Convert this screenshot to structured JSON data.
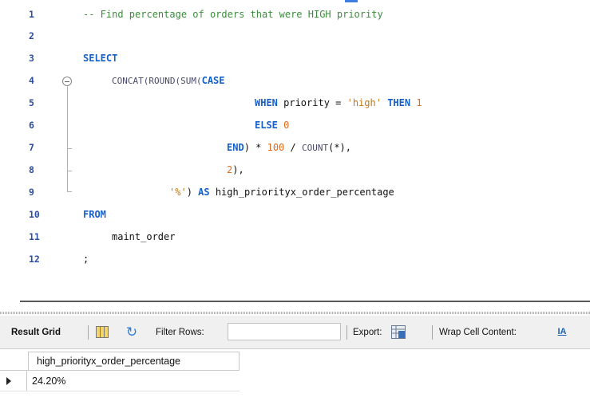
{
  "editor": {
    "line_numbers": [
      "1",
      "2",
      "3",
      "4",
      "5",
      "6",
      "7",
      "8",
      "9",
      "10",
      "11",
      "12"
    ],
    "line1_comment": "-- Find percentage of orders that were HIGH priority",
    "line3_select": "SELECT",
    "line4_concat": "CONCAT(",
    "line4_round": "ROUND(",
    "line4_sum": "SUM(",
    "line4_case": "CASE",
    "line5_when": "WHEN",
    "line5_col": " priority = ",
    "line5_str": "'high'",
    "line5_then": " THEN ",
    "line5_num": "1",
    "line6_else": "ELSE ",
    "line6_num": "0",
    "line7_end": "END",
    "line7_mid": ") * ",
    "line7_num": "100",
    "line7_div": " / ",
    "line7_count": "COUNT",
    "line7_tail": "(*),",
    "line8_num": "2",
    "line8_tail": "),",
    "line9_str": "'%'",
    "line9_paren": ") ",
    "line9_as": "AS",
    "line9_alias": " high_priorityx_order_percentage",
    "line10_from": "FROM",
    "line11_table": "maint_order",
    "line12_semi": ";"
  },
  "toolbar": {
    "result_grid_label": "Result Grid",
    "filter_rows_label": "Filter Rows:",
    "filter_value": "",
    "export_label": "Export:",
    "wrap_label": "Wrap Cell Content:",
    "wrap_icon_glyph": "IA"
  },
  "grid": {
    "columns": [
      "high_priorityx_order_percentage"
    ],
    "rows": [
      [
        "24.20%"
      ]
    ]
  },
  "colors": {
    "keyword": "#1560c8",
    "comment": "#3c8c3c",
    "number": "#e06a1b",
    "string": "#cc7711",
    "line_number": "#2d4ea0"
  },
  "icons": [
    "fold-minus-icon",
    "result-grid-icon",
    "refresh-icon",
    "export-icon",
    "wrap-cell-icon",
    "row-pointer-icon"
  ]
}
